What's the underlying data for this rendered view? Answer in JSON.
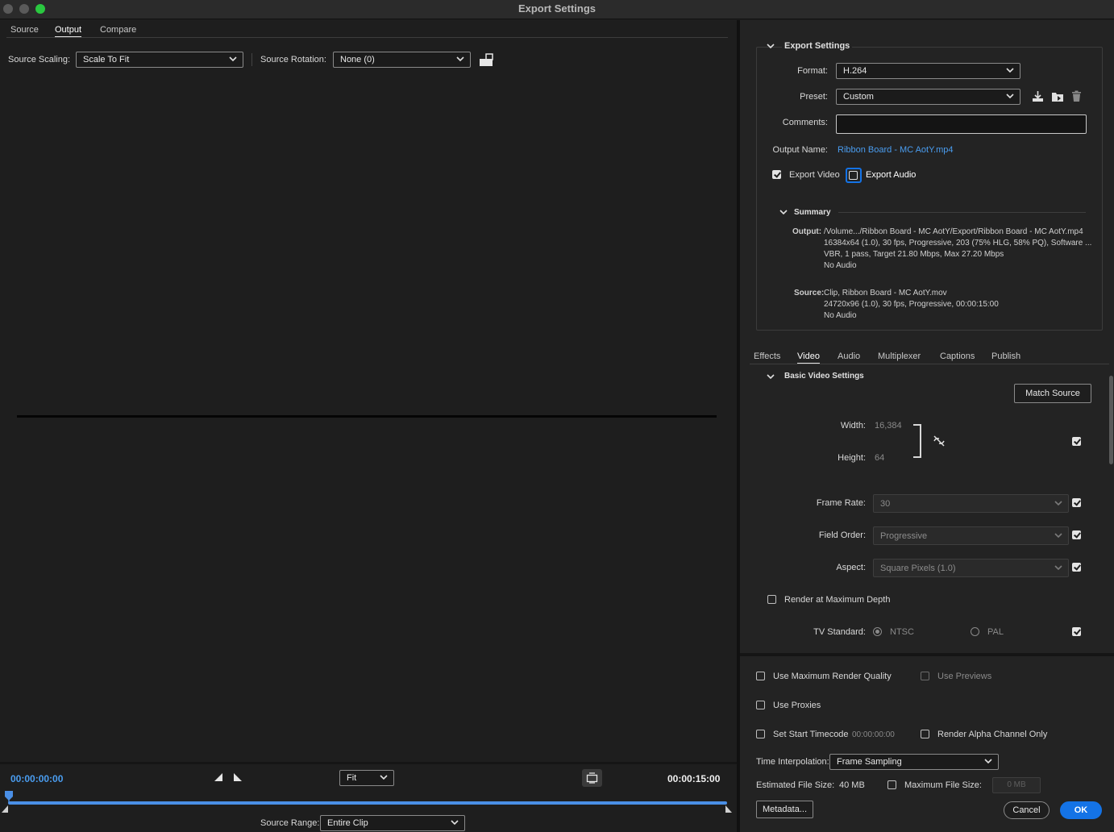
{
  "window": {
    "title": "Export Settings"
  },
  "tabs": [
    {
      "label": "Source",
      "active": false
    },
    {
      "label": "Output",
      "active": true
    },
    {
      "label": "Compare",
      "active": false
    }
  ],
  "source_controls": {
    "scaling_label": "Source Scaling:",
    "scaling_value": "Scale To Fit",
    "rotation_label": "Source Rotation:",
    "rotation_value": "None (0)"
  },
  "timeline": {
    "current_time": "00:00:00:00",
    "end_time": "00:00:15:00",
    "zoom_value": "Fit",
    "source_range_label": "Source Range:",
    "source_range_value": "Entire Clip"
  },
  "export_settings": {
    "heading": "Export Settings",
    "format_label": "Format:",
    "format_value": "H.264",
    "preset_label": "Preset:",
    "preset_value": "Custom",
    "comments_label": "Comments:",
    "comments_value": "",
    "output_name_label": "Output Name:",
    "output_name_value": "Ribbon Board - MC AotY.mp4",
    "export_video_label": "Export Video",
    "export_video_checked": true,
    "export_audio_label": "Export Audio",
    "export_audio_checked": false
  },
  "summary": {
    "heading": "Summary",
    "output_key": "Output:",
    "output_lines": [
      "/Volume.../Ribbon Board - MC AotY/Export/Ribbon Board - MC AotY.mp4",
      "16384x64 (1.0), 30 fps, Progressive, 203 (75% HLG, 58% PQ), Software ...",
      "VBR, 1 pass, Target 21.80 Mbps, Max 27.20 Mbps",
      "No Audio"
    ],
    "source_key": "Source:",
    "source_lines": [
      "Clip, Ribbon Board - MC AotY.mov",
      "24720x96 (1.0), 30 fps, Progressive, 00:00:15:00",
      "No Audio"
    ]
  },
  "settings_tabs": [
    {
      "label": "Effects",
      "active": false
    },
    {
      "label": "Video",
      "active": true
    },
    {
      "label": "Audio",
      "active": false
    },
    {
      "label": "Multiplexer",
      "active": false
    },
    {
      "label": "Captions",
      "active": false
    },
    {
      "label": "Publish",
      "active": false
    }
  ],
  "video_settings": {
    "heading": "Basic Video Settings",
    "match_source_label": "Match Source",
    "width_label": "Width:",
    "width_value": "16,384",
    "height_label": "Height:",
    "height_value": "64",
    "frame_rate_label": "Frame Rate:",
    "frame_rate_value": "30",
    "field_order_label": "Field Order:",
    "field_order_value": "Progressive",
    "aspect_label": "Aspect:",
    "aspect_value": "Square Pixels (1.0)",
    "render_max_depth_label": "Render at Maximum Depth",
    "tv_standard_label": "TV Standard:",
    "ntsc_label": "NTSC",
    "pal_label": "PAL"
  },
  "bottom": {
    "use_max_quality_label": "Use Maximum Render Quality",
    "use_previews_label": "Use Previews",
    "use_proxies_label": "Use Proxies",
    "set_start_tc_label": "Set Start Timecode",
    "start_tc_value": "00:00:00:00",
    "render_alpha_label": "Render Alpha Channel Only",
    "time_interp_label": "Time Interpolation:",
    "time_interp_value": "Frame Sampling",
    "est_size_label": "Estimated File Size:",
    "est_size_value": "40 MB",
    "max_file_size_label": "Maximum File Size:",
    "max_file_size_value": "0 MB",
    "metadata_label": "Metadata...",
    "cancel_label": "Cancel",
    "ok_label": "OK"
  },
  "colors": {
    "accent": "#1473e6",
    "link": "#4a9df0",
    "background": "#1e1e1e"
  }
}
